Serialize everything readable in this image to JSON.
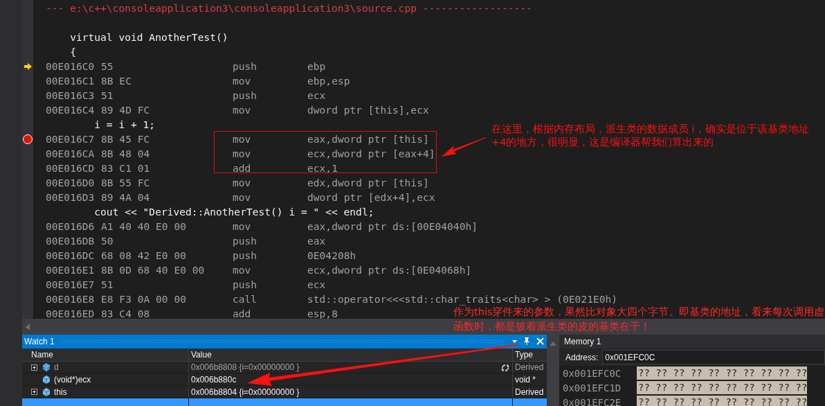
{
  "disassembly": {
    "header": "--- e:\\c++\\consoleapplication3\\consoleapplication3\\source.cpp ------------------",
    "lines": [
      {
        "kind": "blank"
      },
      {
        "kind": "source",
        "text": "    virtual void AnotherTest()"
      },
      {
        "kind": "source",
        "text": "    {"
      },
      {
        "kind": "asm",
        "current": true,
        "breakpoint": false,
        "address": "00E016C0",
        "bytes": "55",
        "mnemonic": "push",
        "operands": "ebp"
      },
      {
        "kind": "asm",
        "current": false,
        "breakpoint": false,
        "address": "00E016C1",
        "bytes": "8B EC",
        "mnemonic": "mov",
        "operands": "ebp,esp"
      },
      {
        "kind": "asm",
        "current": false,
        "breakpoint": false,
        "address": "00E016C3",
        "bytes": "51",
        "mnemonic": "push",
        "operands": "ecx"
      },
      {
        "kind": "asm",
        "current": false,
        "breakpoint": false,
        "address": "00E016C4",
        "bytes": "89 4D FC",
        "mnemonic": "mov",
        "operands": "dword ptr [this],ecx"
      },
      {
        "kind": "source",
        "text": "        i = i + 1;"
      },
      {
        "kind": "asm",
        "current": false,
        "breakpoint": true,
        "address": "00E016C7",
        "bytes": "8B 45 FC",
        "mnemonic": "mov",
        "operands": "eax,dword ptr [this]"
      },
      {
        "kind": "asm",
        "current": false,
        "breakpoint": false,
        "address": "00E016CA",
        "bytes": "8B 48 04",
        "mnemonic": "mov",
        "operands": "ecx,dword ptr [eax+4]"
      },
      {
        "kind": "asm",
        "current": false,
        "breakpoint": false,
        "address": "00E016CD",
        "bytes": "83 C1 01",
        "mnemonic": "add",
        "operands": "ecx,1"
      },
      {
        "kind": "asm",
        "current": false,
        "breakpoint": false,
        "address": "00E016D0",
        "bytes": "8B 55 FC",
        "mnemonic": "mov",
        "operands": "edx,dword ptr [this]"
      },
      {
        "kind": "asm",
        "current": false,
        "breakpoint": false,
        "address": "00E016D3",
        "bytes": "89 4A 04",
        "mnemonic": "mov",
        "operands": "dword ptr [edx+4],ecx"
      },
      {
        "kind": "source",
        "text": "        cout << \"Derived::AnotherTest() i = \" << endl;"
      },
      {
        "kind": "asm",
        "current": false,
        "breakpoint": false,
        "address": "00E016D6",
        "bytes": "A1 40 40 E0 00",
        "mnemonic": "mov",
        "operands": "eax,dword ptr ds:[00E04040h]"
      },
      {
        "kind": "asm",
        "current": false,
        "breakpoint": false,
        "address": "00E016DB",
        "bytes": "50",
        "mnemonic": "push",
        "operands": "eax"
      },
      {
        "kind": "asm",
        "current": false,
        "breakpoint": false,
        "address": "00E016DC",
        "bytes": "68 08 42 E0 00",
        "mnemonic": "push",
        "operands": "0E04208h"
      },
      {
        "kind": "asm",
        "current": false,
        "breakpoint": false,
        "address": "00E016E1",
        "bytes": "8B 0D 68 40 E0 00",
        "mnemonic": "mov",
        "operands": "ecx,dword ptr ds:[0E04068h]"
      },
      {
        "kind": "asm",
        "current": false,
        "breakpoint": false,
        "address": "00E016E7",
        "bytes": "51",
        "mnemonic": "push",
        "operands": "ecx"
      },
      {
        "kind": "asm",
        "current": false,
        "breakpoint": false,
        "address": "00E016E8",
        "bytes": "E8 F3 0A 00 00",
        "mnemonic": "call",
        "operands": "std::operator<<<std::char_traits<char> > (0E021E0h)"
      },
      {
        "kind": "asm",
        "current": false,
        "breakpoint": false,
        "address": "00E016ED",
        "bytes": "83 C4 08",
        "mnemonic": "add",
        "operands": "esp,8"
      }
    ]
  },
  "watch": {
    "title": "Watch 1",
    "columns": [
      "Name",
      "Value",
      "Type"
    ],
    "rows": [
      {
        "kind": "object",
        "selected": false,
        "expandable": true,
        "stale": true,
        "name": "d",
        "value": "0x006b8808 {i=0x00000000 }",
        "type": "Derived"
      },
      {
        "kind": "field",
        "selected": false,
        "expandable": false,
        "stale": false,
        "name": "(void*)ecx",
        "value": "0x006b880c",
        "type": "void *"
      },
      {
        "kind": "field",
        "selected": false,
        "expandable": true,
        "stale": false,
        "name": "this",
        "value": "0x006b8804 {i=0x00000000 }",
        "type": "Derived"
      },
      {
        "kind": "empty",
        "selected": true
      }
    ]
  },
  "memory": {
    "title": "Memory 1",
    "address_label": "Address:",
    "address_value": "0x001EFC0C",
    "rows": [
      {
        "address": "0x001EFC0C",
        "bytes": "?? ?? ?? ?? ?? ?? ?? ?? ?? ??"
      },
      {
        "address": "0x001EFC1D",
        "bytes": "?? ?? ?? ?? ?? ?? ?? ?? ?? ??"
      },
      {
        "address": "0x001EFC2E",
        "bytes": "?? ?? ?? ?? ?? ?? ?? ?? ?? ??"
      }
    ]
  },
  "annotations": [
    {
      "kind": "code_note",
      "text": "在这里，根据内存布局，派生类的数据成员 i，确实是位于该基类地址+4的地方，很明显，这是编译器帮我们算出来的"
    },
    {
      "kind": "watch_note",
      "text": "作为this穿件来的参数，果然比对象大四个字节。即基类的地址，看来每次调用虚函数时，都是披着派生类的皮的基类在干！"
    }
  ]
}
